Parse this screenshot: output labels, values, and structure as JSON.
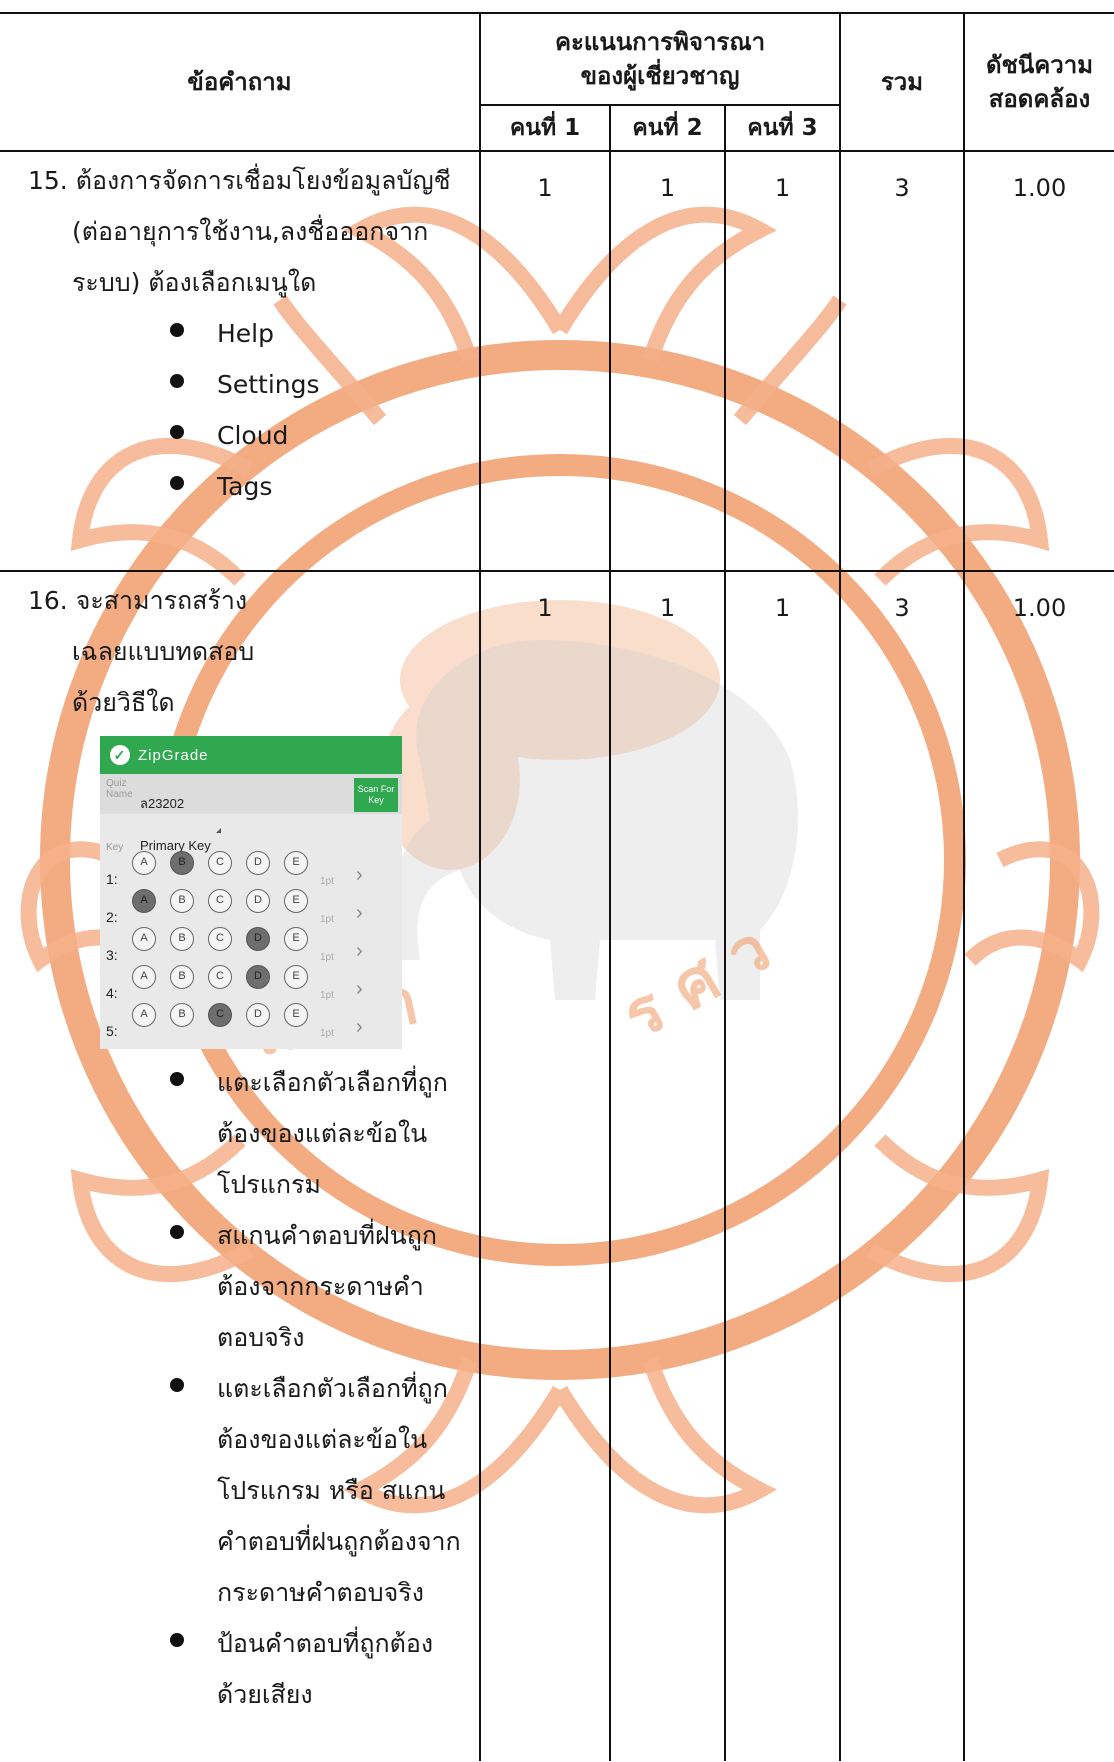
{
  "header": {
    "question_col": "ข้อคำถาม",
    "experts_group": "คะแนนการพิจารณาของผู้เชี่ยวชาญ",
    "expert_1": "คนที่ 1",
    "expert_2": "คนที่ 2",
    "expert_3": "คนที่ 3",
    "total_col": "รวม",
    "ioc_col": "ดัชนีความสอดคล้อง"
  },
  "rows": [
    {
      "number": "15.",
      "question": "ต้องการจัดการเชื่อมโยงข้อมูลบัญชี (ต่ออายุการใช้งาน,ลงชื่อออกจากระบบ) ต้องเลือกเมนูใด",
      "options": [
        "Help",
        "Settings",
        "Cloud",
        "Tags"
      ],
      "scores": [
        "1",
        "1",
        "1"
      ],
      "total": "3",
      "ioc": "1.00"
    },
    {
      "number": "16.",
      "question": "จะสามารถสร้างเฉลยแบบทดสอบด้วยวิธีใด",
      "options": [
        "แตะเลือกตัวเลือกที่ถูกต้องของแต่ละข้อในโปรแกรม",
        "สแกนคำตอบที่ฝนถูกต้องจากกระดาษคำตอบจริง",
        "แตะเลือกตัวเลือกที่ถูกต้องของแต่ละข้อในโปรแกรม หรือ สแกนคำตอบที่ฝนถูกต้องจากกระดาษคำตอบจริง",
        "ป้อนคำตอบที่ถูกต้องด้วยเสียง"
      ],
      "scores": [
        "1",
        "1",
        "1"
      ],
      "total": "3",
      "ioc": "1.00"
    }
  ],
  "zipgrade": {
    "brand": "ZipGrade",
    "quiz_label": "Quiz Name",
    "quiz_value": "ล23202",
    "scan_label": "Scan For Key",
    "key_label": "Key",
    "key_value": "Primary Key",
    "bubble_letters": [
      "A",
      "B",
      "C",
      "D",
      "E"
    ],
    "point_label": "1pt",
    "answers": [
      {
        "num": "1:",
        "filled": "B"
      },
      {
        "num": "2:",
        "filled": "A"
      },
      {
        "num": "3:",
        "filled": "D"
      },
      {
        "num": "4:",
        "filled": "D"
      },
      {
        "num": "5:",
        "filled": "C"
      }
    ],
    "brand_color": "#2fa84f"
  },
  "watermark": {
    "color": "#f0a070",
    "text": "มหาวิทยาลัยนเรศวร"
  }
}
